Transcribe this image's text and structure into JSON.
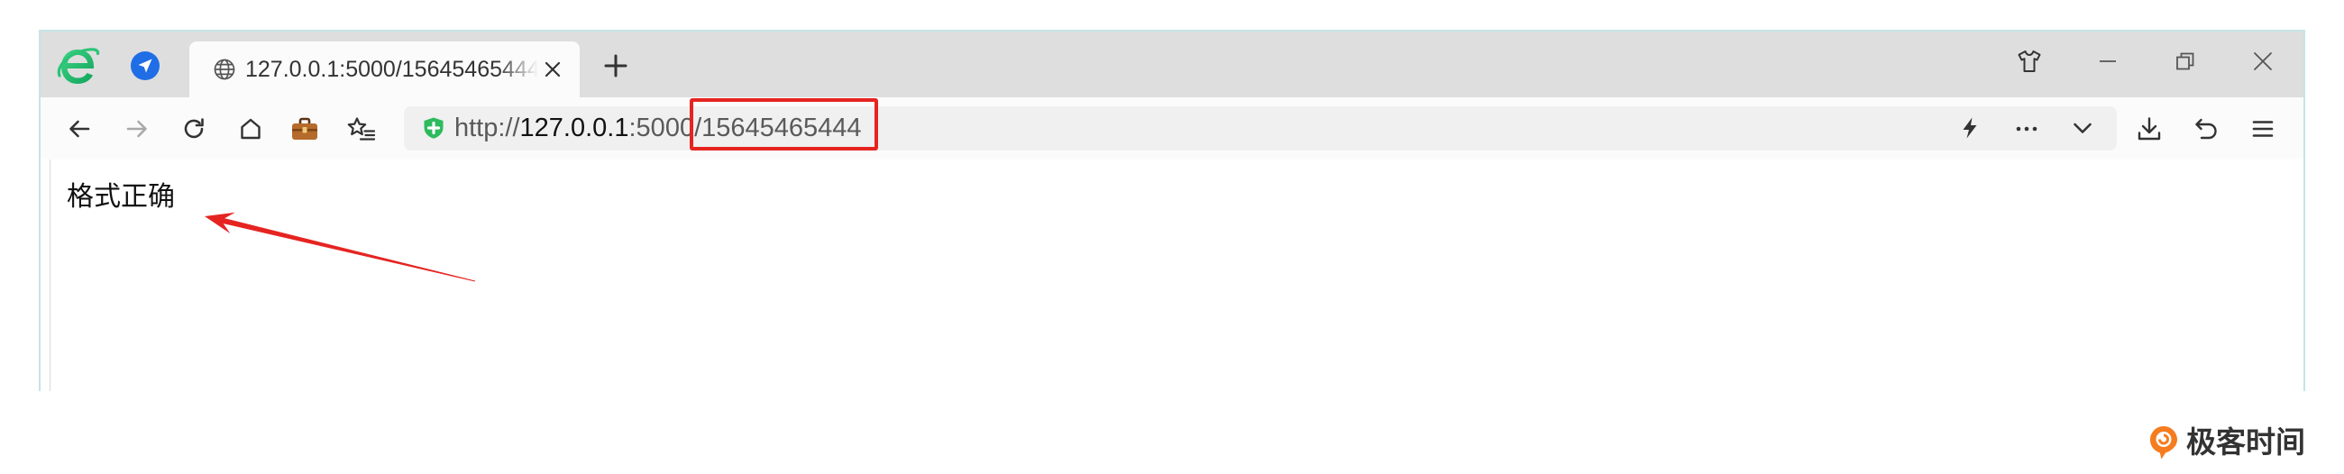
{
  "browser": {
    "app_logo_icon": "browser-e-logo-icon",
    "pinned_icon": "navigation-arrow-icon",
    "active_tab": {
      "favicon_icon": "globe-icon",
      "title": "127.0.0.1:5000/15645465444",
      "close_icon": "close-icon"
    },
    "new_tab_icon": "plus-icon",
    "window_controls": {
      "skin_icon": "shirt-icon",
      "minimize_icon": "minimize-icon",
      "restore_icon": "restore-icon",
      "close_icon": "close-icon"
    }
  },
  "toolbar": {
    "nav_icons": [
      "back-arrow-icon",
      "forward-arrow-icon",
      "reload-icon",
      "home-icon",
      "briefcase-icon",
      "favorites-star-icon"
    ],
    "forward_enabled": false,
    "address_bar": {
      "security_icon": "shield-plus-icon",
      "url_scheme": "http://",
      "url_host": "127.0.0.1",
      "url_port": ":5000",
      "url_path": "/15645465444",
      "action_icons": [
        "lightning-icon",
        "more-dots-icon",
        "chevron-down-icon"
      ]
    },
    "right_icons": [
      "download-icon",
      "undo-icon",
      "menu-icon"
    ]
  },
  "page": {
    "message": "格式正确"
  },
  "watermark": {
    "logo_icon": "geektime-logo-icon",
    "text": "极客时间"
  },
  "colors": {
    "tab_strip_bg": "#dedede",
    "address_bar_bg": "#f0f0f0",
    "window_border": "#c6e3e8",
    "annotation_red": "#e52421",
    "security_green": "#2dbb5d",
    "pinned_icon_blue": "#1f6ee6",
    "watermark_orange": "#f57c1f"
  }
}
